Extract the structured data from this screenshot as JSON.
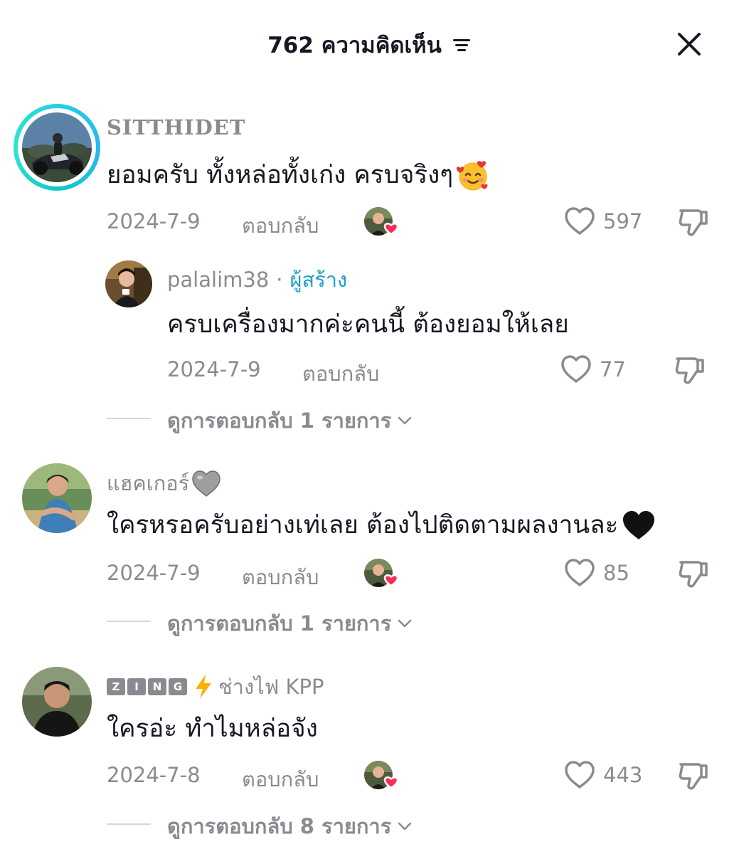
{
  "header": {
    "title": "762 ความคิดเห็น"
  },
  "comments": [
    {
      "username": "SITTHIDET",
      "text": "ยอมครับ ทั้งหล่อทั้งเก่ง ครบจริงๆ",
      "date": "2024-7-9",
      "reply_label": "ตอบกลับ",
      "likes": "597"
    },
    {
      "username": "แฮคเกอร์",
      "text": "ใครหรอครับอย่างเท่เลย ต้องไปติดตามผลงานละ",
      "date": "2024-7-9",
      "reply_label": "ตอบกลับ",
      "likes": "85",
      "view_replies": "ดูการตอบกลับ 1 รายการ"
    },
    {
      "username_badge": "ZING",
      "username": "ช่างไฟ KPP",
      "text": "ใครอ่ะ ทำไมหล่อจัง",
      "date": "2024-7-8",
      "reply_label": "ตอบกลับ",
      "likes": "443",
      "view_replies": "ดูการตอบกลับ 8 รายการ"
    }
  ],
  "reply": {
    "username": "palalim38",
    "separator": "·",
    "creator_label": "ผู้สร้าง",
    "text": "ครบเครื่องมากค่ะคนนี้ ต้องยอมให้เลย",
    "date": "2024-7-9",
    "reply_label": "ตอบกลับ",
    "likes": "77",
    "view_replies": "ดูการตอบกลับ 1 รายการ"
  },
  "icons": {
    "sort": "sort-lines-icon",
    "close": "close-icon",
    "like": "heart-outline-icon",
    "dislike": "thumbs-down-icon",
    "chevron": "chevron-down-icon",
    "creator_liked": "creator-liked-avatar-heart-icon"
  },
  "colors": {
    "text_primary": "#161823",
    "text_secondary": "#8a8b91",
    "creator_accent": "#1da1c9",
    "heart_badge": "#fe2c55",
    "story_ring": "#25d0e0"
  }
}
